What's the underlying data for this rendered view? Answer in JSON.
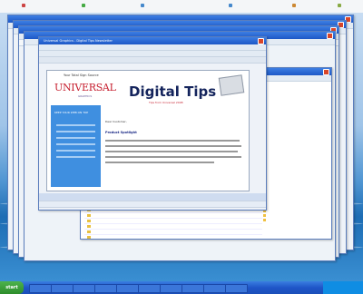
{
  "taskbar": {
    "start_label": "start",
    "items": [
      "",
      "",
      "",
      "",
      "",
      "",
      "",
      "",
      "",
      ""
    ],
    "clock": ""
  },
  "front_window": {
    "title": "Universal Graphics - Digital Tips Newsletter"
  },
  "document": {
    "logo_tagline": "Your Total Sign Source",
    "logo_main": "UNIVERSAL",
    "logo_sub": "GRAPHICS",
    "heading": "Digital Tips",
    "subheading": "Tips from Universal 2008",
    "sidebar_heading": "KEEP YOUR WEB ON TOP",
    "greeting": "Dear Customer,",
    "section_title": "Product Spotlight"
  },
  "colors": {
    "desktop_sky": "#c7dcf2",
    "desktop_sea": "#1d6db4",
    "titlebar": "#1d58c6",
    "logo_red": "#c61f2f",
    "tips_navy": "#14245c",
    "sidebar_blue": "#3f8fe0"
  }
}
